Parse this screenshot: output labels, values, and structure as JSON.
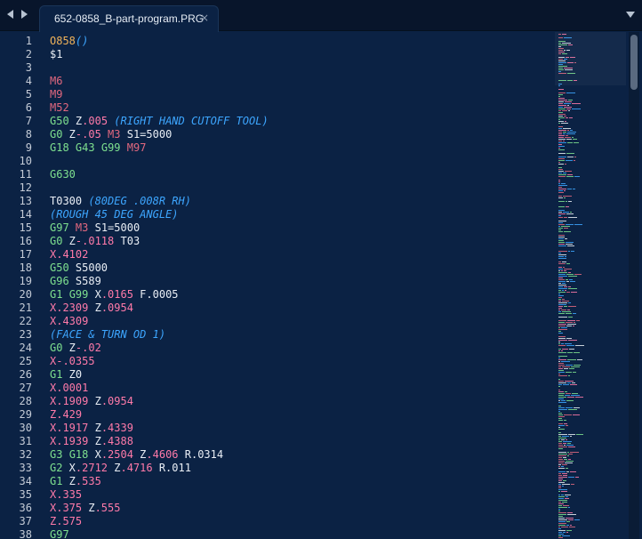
{
  "tabs": [
    {
      "title": "652-0858_B-part-program.PRG",
      "close": "×"
    }
  ],
  "lines": [
    [
      [
        "d",
        "O858"
      ],
      [
        "c",
        "()"
      ]
    ],
    [
      [
        "t",
        "$1"
      ]
    ],
    [],
    [
      [
        "m",
        "M6"
      ]
    ],
    [
      [
        "m",
        "M9"
      ]
    ],
    [
      [
        "m",
        "M52"
      ]
    ],
    [
      [
        "g",
        "G50"
      ],
      [
        "t",
        " Z"
      ],
      [
        "n",
        ".005"
      ],
      [
        "t",
        " "
      ],
      [
        "c",
        "(RIGHT HAND CUTOFF TOOL)"
      ]
    ],
    [
      [
        "g",
        "G0"
      ],
      [
        "t",
        " Z"
      ],
      [
        "n",
        "-.05"
      ],
      [
        "t",
        " "
      ],
      [
        "m",
        "M3"
      ],
      [
        "t",
        " S1=5000"
      ]
    ],
    [
      [
        "g",
        "G18"
      ],
      [
        "t",
        " "
      ],
      [
        "g",
        "G43"
      ],
      [
        "t",
        " "
      ],
      [
        "g",
        "G99"
      ],
      [
        "t",
        " "
      ],
      [
        "m",
        "M97"
      ]
    ],
    [],
    [
      [
        "g",
        "G630"
      ]
    ],
    [],
    [
      [
        "t",
        "T0300 "
      ],
      [
        "c",
        "(80DEG .008R RH)"
      ]
    ],
    [
      [
        "c",
        "(ROUGH 45 DEG ANGLE)"
      ]
    ],
    [
      [
        "g",
        "G97"
      ],
      [
        "t",
        " "
      ],
      [
        "m",
        "M3"
      ],
      [
        "t",
        " S1=5000"
      ]
    ],
    [
      [
        "g",
        "G0"
      ],
      [
        "t",
        " Z"
      ],
      [
        "n",
        "-.0118"
      ],
      [
        "t",
        " T03"
      ]
    ],
    [
      [
        "n",
        "X.4102"
      ]
    ],
    [
      [
        "g",
        "G50"
      ],
      [
        "t",
        " S5000"
      ]
    ],
    [
      [
        "g",
        "G96"
      ],
      [
        "t",
        " S589"
      ]
    ],
    [
      [
        "g",
        "G1"
      ],
      [
        "t",
        " "
      ],
      [
        "g",
        "G99"
      ],
      [
        "t",
        " X"
      ],
      [
        "n",
        ".0165"
      ],
      [
        "t",
        " F.0005"
      ]
    ],
    [
      [
        "n",
        "X.2309"
      ],
      [
        "t",
        " Z"
      ],
      [
        "n",
        ".0954"
      ]
    ],
    [
      [
        "n",
        "X.4309"
      ]
    ],
    [
      [
        "c",
        "(FACE & TURN OD 1)"
      ]
    ],
    [
      [
        "g",
        "G0"
      ],
      [
        "t",
        " Z"
      ],
      [
        "n",
        "-.02"
      ]
    ],
    [
      [
        "n",
        "X-.0355"
      ]
    ],
    [
      [
        "g",
        "G1"
      ],
      [
        "t",
        " Z0"
      ]
    ],
    [
      [
        "n",
        "X.0001"
      ]
    ],
    [
      [
        "n",
        "X.1909"
      ],
      [
        "t",
        " Z"
      ],
      [
        "n",
        ".0954"
      ]
    ],
    [
      [
        "n",
        "Z.429"
      ]
    ],
    [
      [
        "n",
        "X.1917"
      ],
      [
        "t",
        " Z"
      ],
      [
        "n",
        ".4339"
      ]
    ],
    [
      [
        "n",
        "X.1939"
      ],
      [
        "t",
        " Z"
      ],
      [
        "n",
        ".4388"
      ]
    ],
    [
      [
        "g",
        "G3"
      ],
      [
        "t",
        " "
      ],
      [
        "g",
        "G18"
      ],
      [
        "t",
        " X"
      ],
      [
        "n",
        ".2504"
      ],
      [
        "t",
        " Z"
      ],
      [
        "n",
        ".4606"
      ],
      [
        "t",
        " R.0314"
      ]
    ],
    [
      [
        "g",
        "G2"
      ],
      [
        "t",
        " X"
      ],
      [
        "n",
        ".2712"
      ],
      [
        "t",
        " Z"
      ],
      [
        "n",
        ".4716"
      ],
      [
        "t",
        " R.011"
      ]
    ],
    [
      [
        "g",
        "G1"
      ],
      [
        "t",
        " Z"
      ],
      [
        "n",
        ".535"
      ]
    ],
    [
      [
        "n",
        "X.335"
      ]
    ],
    [
      [
        "n",
        "X.375"
      ],
      [
        "t",
        " Z"
      ],
      [
        "n",
        ".555"
      ]
    ],
    [
      [
        "n",
        "Z.575"
      ]
    ],
    [
      [
        "g",
        "G97"
      ]
    ]
  ],
  "colors": {
    "background": "#0b2244",
    "gcode": "#7ee08f",
    "mcode": "#e2687f",
    "number": "#ff7aa9",
    "comment": "#3da6ff",
    "program_number": "#f0b35a",
    "text": "#e9eef5"
  },
  "icons": {
    "back": "chevron-left-icon",
    "forward": "chevron-right-icon",
    "tab_menu": "triangle-down-icon"
  }
}
